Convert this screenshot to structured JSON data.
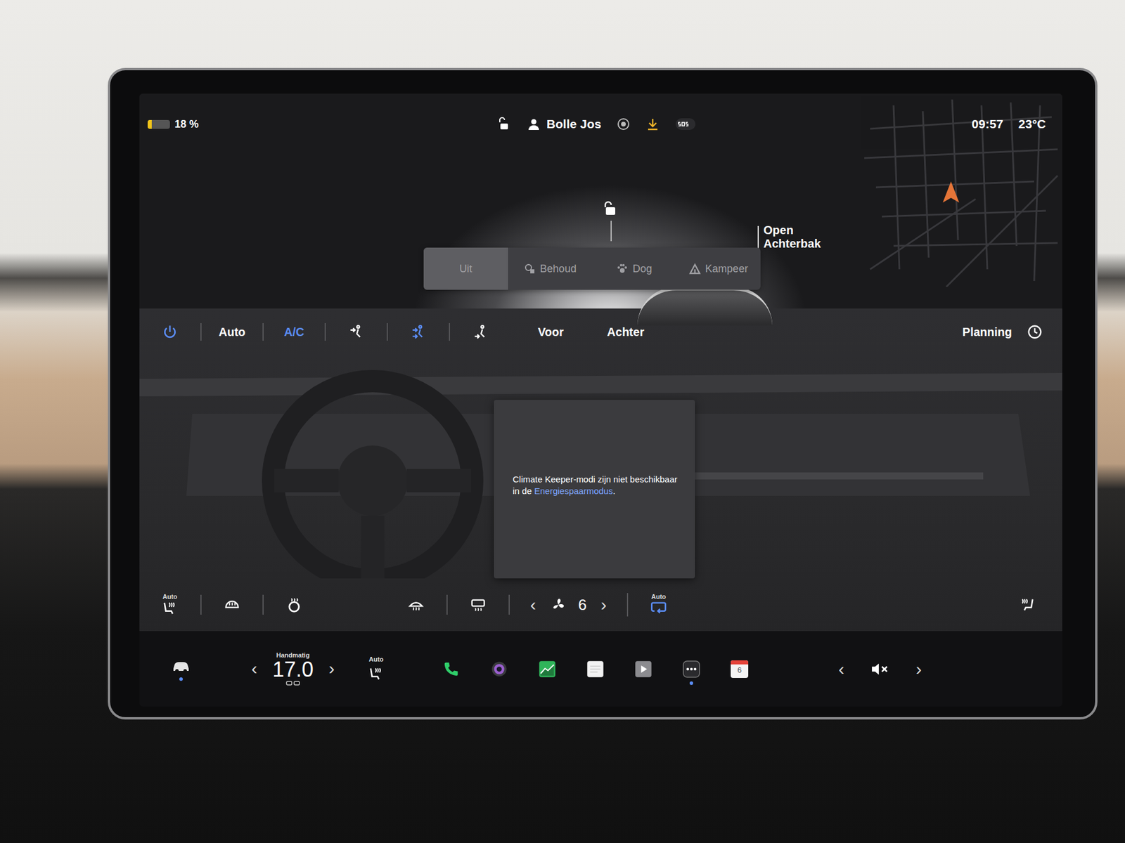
{
  "status_bar": {
    "battery": {
      "reading": "18 %",
      "level": 0.18
    },
    "user": "Bolle Jos",
    "time": "09:57",
    "outside_temp": "23°C"
  },
  "car_view": {
    "trunk": {
      "lines": [
        "Open",
        "Achterbak"
      ]
    }
  },
  "climate_keeper": {
    "disabled": true,
    "modes": [
      {
        "label": "Uit",
        "selected": true
      },
      {
        "label": "Behoud",
        "selected": false
      },
      {
        "label": "Dog",
        "selected": false
      },
      {
        "label": "Kampeer",
        "selected": false
      }
    ]
  },
  "climate_toolbar": {
    "power_on": true,
    "auto": {
      "label": "Auto",
      "on": false
    },
    "ac": {
      "label": "A/C",
      "on": true
    },
    "airflow": [
      {
        "selected": false
      },
      {
        "selected": true
      },
      {
        "selected": false
      }
    ],
    "zones": [
      {
        "label": "Voor",
        "selected": false
      },
      {
        "label": "Achter",
        "selected": false
      }
    ],
    "planning": "Planning"
  },
  "notice": {
    "text": "Climate Keeper-modi zijn niet beschikbaar in de ",
    "link": "Energiespaarmodus",
    "end": "."
  },
  "climate_controls": {
    "seat_left": {
      "label": "Auto"
    },
    "fan": {
      "prev": "‹",
      "speed": "6",
      "next": "›"
    },
    "recirculate": {
      "label": "Auto",
      "on": true
    }
  },
  "dock": {
    "car": {
      "selected": true
    },
    "temperature": {
      "mode": "Handmatig",
      "prev": "‹",
      "value": "17.0",
      "next": "›"
    },
    "seat": {
      "label": "Auto"
    },
    "apps": [
      {
        "kind": "phone",
        "color": "#2fce6a",
        "selected": false
      },
      {
        "kind": "camera",
        "color": "#9b5fd0",
        "selected": false
      },
      {
        "kind": "chart",
        "color": "#2fb45a",
        "selected": false
      },
      {
        "kind": "notes",
        "color": "#f2f2f2",
        "selected": false
      },
      {
        "kind": "media",
        "color": "#8c8c90",
        "selected": false
      },
      {
        "kind": "more",
        "color": "#2a2a2d",
        "selected": true
      },
      {
        "kind": "calendar",
        "color": "#e5433a",
        "label": "6",
        "selected": false
      }
    ],
    "volume": {
      "prev": "‹",
      "muted": true,
      "next": "›"
    }
  }
}
